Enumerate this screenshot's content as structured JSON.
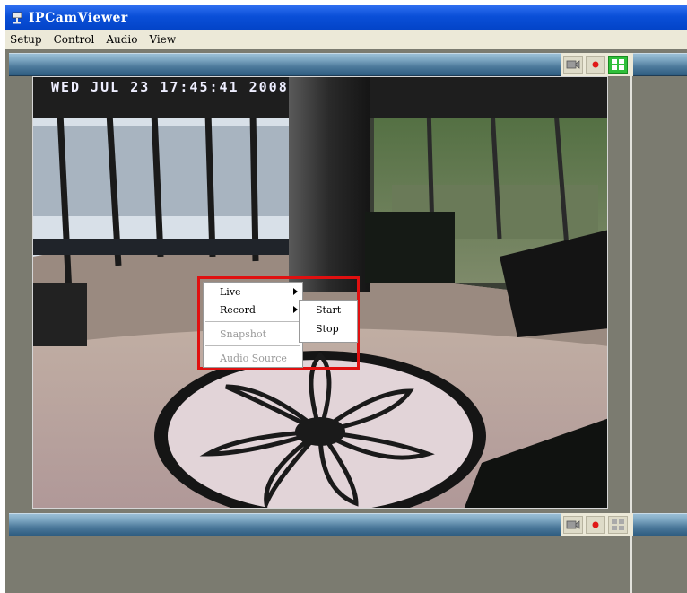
{
  "window": {
    "title": "IPCamViewer"
  },
  "menubar": {
    "items": [
      "Setup",
      "Control",
      "Audio",
      "View"
    ]
  },
  "video": {
    "timestamp": "WED JUL 23 17:45:41 2008"
  },
  "context_menu": {
    "items": [
      {
        "label": "Live",
        "has_submenu": true,
        "enabled": true
      },
      {
        "label": "Record",
        "has_submenu": true,
        "enabled": true
      },
      {
        "label": "Snapshot",
        "has_submenu": false,
        "enabled": false
      },
      {
        "label": "Audio Source",
        "has_submenu": false,
        "enabled": false
      }
    ],
    "submenu": {
      "items": [
        "Start",
        "Stop"
      ]
    }
  },
  "colors": {
    "highlight_box": "#e01010",
    "titlebar": "#0a4fd8",
    "frame": "#7b7b70"
  },
  "icons": {
    "record": "red-dot-icon",
    "settings": "camera-settings-icon",
    "layout": "green-layout-icon"
  }
}
